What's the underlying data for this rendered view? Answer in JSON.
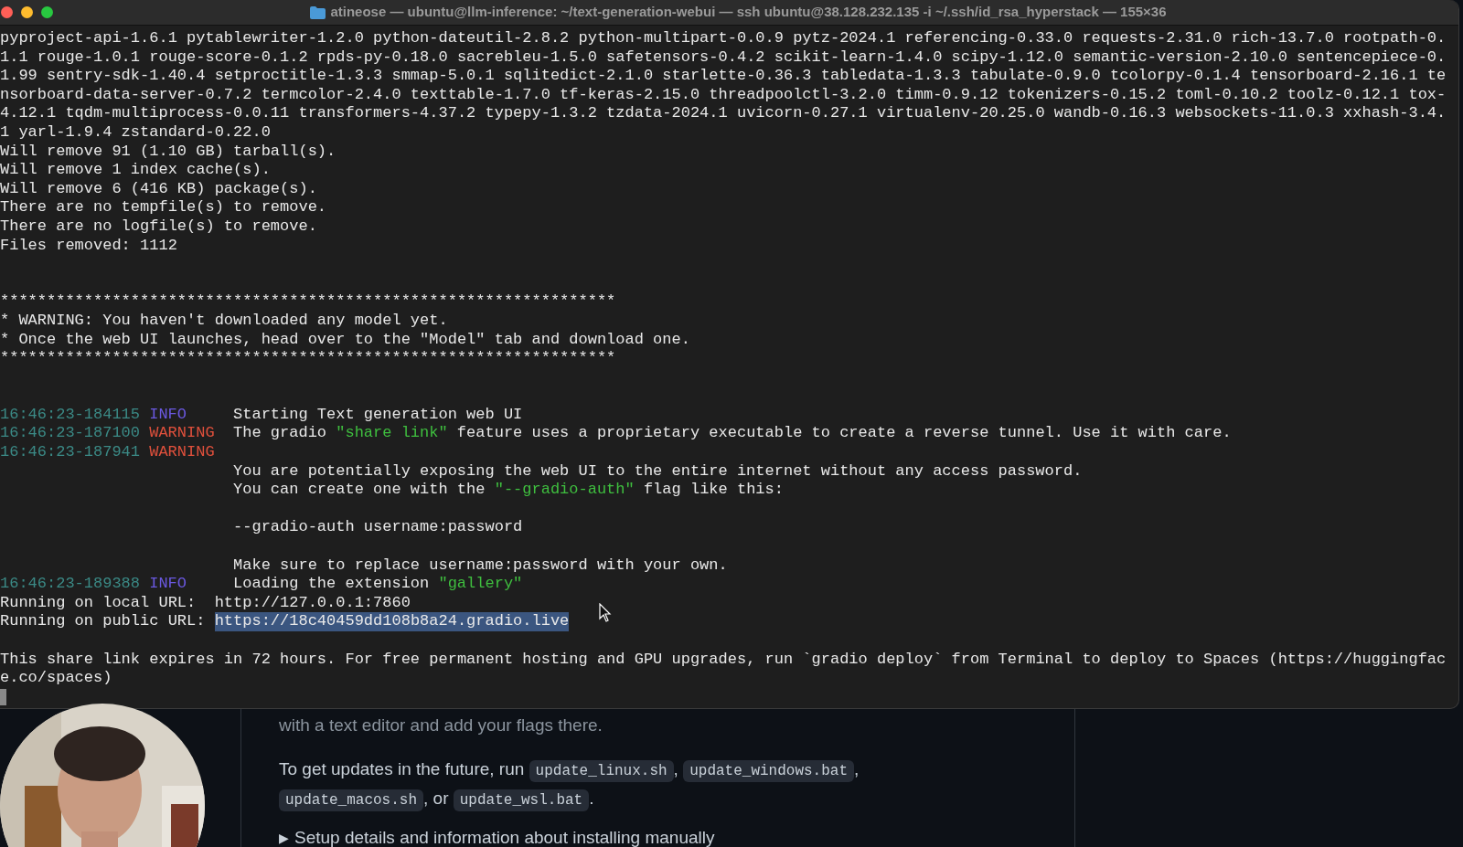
{
  "window": {
    "title": "atineose — ubuntu@llm-inference: ~/text-generation-webui — ssh ubuntu@38.128.232.135 -i ~/.ssh/id_rsa_hyperstack — 155×36"
  },
  "terminal": {
    "lines": [
      {
        "kind": "text",
        "segments": [
          {
            "kind": "plain",
            "text": "pyproject-api-1.6.1 pytablewriter-1.2.0 python-dateutil-2.8.2 python-multipart-0.0.9 pytz-2024.1 referencing-0.33.0 requests-2.31.0 rich-13.7.0 rootpath-0."
          }
        ]
      },
      {
        "kind": "text",
        "segments": [
          {
            "kind": "plain",
            "text": "1.1 rouge-1.0.1 rouge-score-0.1.2 rpds-py-0.18.0 sacrebleu-1.5.0 safetensors-0.4.2 scikit-learn-1.4.0 scipy-1.12.0 semantic-version-2.10.0 sentencepiece-0."
          }
        ]
      },
      {
        "kind": "text",
        "segments": [
          {
            "kind": "plain",
            "text": "1.99 sentry-sdk-1.40.4 setproctitle-1.3.3 smmap-5.0.1 sqlitedict-2.1.0 starlette-0.36.3 tabledata-1.3.3 tabulate-0.9.0 tcolorpy-0.1.4 tensorboard-2.16.1 te"
          }
        ]
      },
      {
        "kind": "text",
        "segments": [
          {
            "kind": "plain",
            "text": "nsorboard-data-server-0.7.2 termcolor-2.4.0 texttable-1.7.0 tf-keras-2.15.0 threadpoolctl-3.2.0 timm-0.9.12 tokenizers-0.15.2 toml-0.10.2 toolz-0.12.1 tox-"
          }
        ]
      },
      {
        "kind": "text",
        "segments": [
          {
            "kind": "plain",
            "text": "4.12.1 tqdm-multiprocess-0.0.11 transformers-4.37.2 typepy-1.3.2 tzdata-2024.1 uvicorn-0.27.1 virtualenv-20.25.0 wandb-0.16.3 websockets-11.0.3 xxhash-3.4."
          }
        ]
      },
      {
        "kind": "text",
        "segments": [
          {
            "kind": "plain",
            "text": "1 yarl-1.9.4 zstandard-0.22.0"
          }
        ]
      },
      {
        "kind": "text",
        "segments": [
          {
            "kind": "plain",
            "text": "Will remove 91 (1.10 GB) tarball(s)."
          }
        ]
      },
      {
        "kind": "text",
        "segments": [
          {
            "kind": "plain",
            "text": "Will remove 1 index cache(s)."
          }
        ]
      },
      {
        "kind": "text",
        "segments": [
          {
            "kind": "plain",
            "text": "Will remove 6 (416 KB) package(s)."
          }
        ]
      },
      {
        "kind": "text",
        "segments": [
          {
            "kind": "plain",
            "text": "There are no tempfile(s) to remove."
          }
        ]
      },
      {
        "kind": "text",
        "segments": [
          {
            "kind": "plain",
            "text": "There are no logfile(s) to remove."
          }
        ]
      },
      {
        "kind": "text",
        "segments": [
          {
            "kind": "plain",
            "text": "Files removed: 1112"
          }
        ]
      },
      {
        "kind": "blank"
      },
      {
        "kind": "blank"
      },
      {
        "kind": "text",
        "segments": [
          {
            "kind": "plain",
            "text": "******************************************************************"
          }
        ]
      },
      {
        "kind": "text",
        "segments": [
          {
            "kind": "plain",
            "text": "* WARNING: You haven't downloaded any model yet."
          }
        ]
      },
      {
        "kind": "text",
        "segments": [
          {
            "kind": "plain",
            "text": "* Once the web UI launches, head over to the \"Model\" tab and download one."
          }
        ]
      },
      {
        "kind": "text",
        "segments": [
          {
            "kind": "plain",
            "text": "******************************************************************"
          }
        ]
      },
      {
        "kind": "blank"
      },
      {
        "kind": "blank"
      },
      {
        "kind": "log",
        "time": "16:46:23-184115",
        "level": "INFO",
        "color": "#6a58e0",
        "segments": [
          {
            "kind": "plain",
            "text": "Starting Text generation web UI"
          }
        ]
      },
      {
        "kind": "log",
        "time": "16:46:23-187100",
        "level": "WARNING",
        "color": "#e0503c",
        "segments": [
          {
            "kind": "plain",
            "text": "The gradio "
          },
          {
            "kind": "string",
            "text": "\"share link\""
          },
          {
            "kind": "plain",
            "text": " feature uses a proprietary executable to create a reverse tunnel. Use it with care."
          }
        ]
      },
      {
        "kind": "log",
        "time": "16:46:23-187941",
        "level": "WARNING",
        "color": "#e0503c"
      },
      {
        "kind": "cont",
        "segments": [
          {
            "kind": "plain",
            "text": "You are potentially exposing the web UI to the entire internet without any access password."
          }
        ]
      },
      {
        "kind": "cont",
        "segments": [
          {
            "kind": "plain",
            "text": "You can create one with the "
          },
          {
            "kind": "string",
            "text": "\"--gradio-auth\""
          },
          {
            "kind": "plain",
            "text": " flag like this:"
          }
        ]
      },
      {
        "kind": "blank"
      },
      {
        "kind": "cont",
        "segments": [
          {
            "kind": "plain",
            "text": "--gradio-auth username:password"
          }
        ]
      },
      {
        "kind": "blank"
      },
      {
        "kind": "cont",
        "segments": [
          {
            "kind": "plain",
            "text": "Make sure to replace username:password with your own."
          }
        ]
      },
      {
        "kind": "log",
        "time": "16:46:23-189388",
        "level": "INFO",
        "color": "#6a58e0",
        "segments": [
          {
            "kind": "plain",
            "text": "Loading the extension "
          },
          {
            "kind": "string",
            "text": "\"gallery\""
          }
        ]
      },
      {
        "kind": "text",
        "segments": [
          {
            "kind": "plain",
            "text": "Running on local URL:  http://127.0.0.1:7860"
          }
        ]
      },
      {
        "kind": "text",
        "segments": [
          {
            "kind": "plain",
            "text": "Running on public URL: "
          },
          {
            "kind": "selected",
            "text": "https://18c40459dd108b8a24.gradio.live"
          }
        ]
      },
      {
        "kind": "blank"
      },
      {
        "kind": "text",
        "segments": [
          {
            "kind": "plain",
            "text": "This share link expires in 72 hours. For free permanent hosting and GPU upgrades, run `gradio deploy` from Terminal to deploy to Spaces (https://huggingfac"
          }
        ]
      },
      {
        "kind": "text",
        "segments": [
          {
            "kind": "plain",
            "text": "e.co/spaces)"
          }
        ]
      },
      {
        "kind": "cursor"
      }
    ]
  },
  "page": {
    "paragraphs": [
      [
        {
          "kind": "text",
          "text": "with a text editor and add your flags there."
        }
      ],
      [
        {
          "kind": "text",
          "text": "To get updates in the future, run "
        },
        {
          "kind": "code",
          "text": "update_linux.sh"
        },
        {
          "kind": "text",
          "text": ", "
        },
        {
          "kind": "code",
          "text": "update_windows.bat"
        },
        {
          "kind": "text",
          "text": ", "
        },
        {
          "kind": "code",
          "text": "update_macos.sh"
        },
        {
          "kind": "text",
          "text": ", or "
        },
        {
          "kind": "code",
          "text": "update_wsl.bat"
        },
        {
          "kind": "text",
          "text": "."
        }
      ]
    ],
    "summary": {
      "marker": "▶",
      "label": "Setup details and information about installing manually"
    }
  }
}
